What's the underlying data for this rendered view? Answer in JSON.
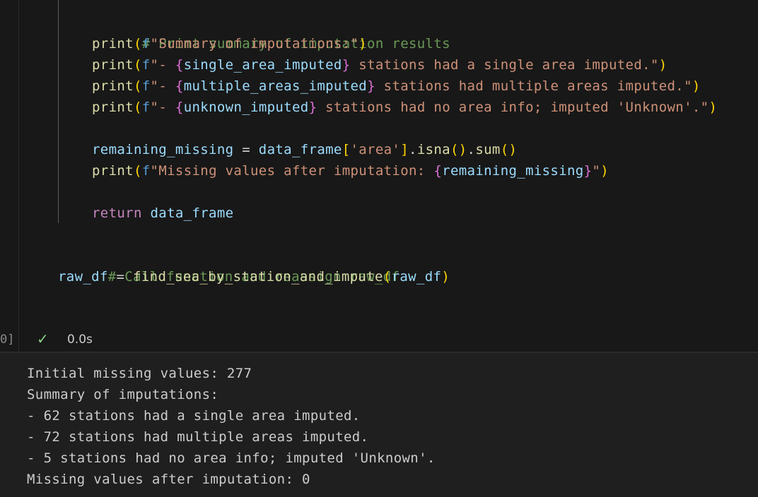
{
  "code": {
    "comment_print_summary": "# Print summary of imputation results",
    "line_summary": {
      "fn": "print",
      "p1": "(",
      "prefix": "f",
      "str": "\"Summary of imputations:\"",
      "p2": ")"
    },
    "line_single": {
      "fn": "print",
      "p1": "(",
      "prefix": "f",
      "s1": "\"- ",
      "b1": "{",
      "var": "single_area_imputed",
      "b2": "}",
      "s2": " stations had a single area imputed.\"",
      "p2": ")"
    },
    "line_multiple": {
      "fn": "print",
      "p1": "(",
      "prefix": "f",
      "s1": "\"- ",
      "b1": "{",
      "var": "multiple_areas_imputed",
      "b2": "}",
      "s2": " stations had multiple areas imputed.\"",
      "p2": ")"
    },
    "line_unknown": {
      "fn": "print",
      "p1": "(",
      "prefix": "f",
      "s1": "\"- ",
      "b1": "{",
      "var": "unknown_imputed",
      "b2": "}",
      "s2": " stations had no area info; imputed 'Unknown'.\"",
      "p2": ")"
    },
    "line_remaining": {
      "var": "remaining_missing",
      "eq": " = ",
      "obj": "data_frame",
      "br1": "[",
      "key": "'area'",
      "br2": "]",
      "dot1": ".",
      "m1": "isna",
      "pa": "()",
      "dot2": ".",
      "m2": "sum",
      "pb": "()"
    },
    "line_missing_print": {
      "fn": "print",
      "p1": "(",
      "prefix": "f",
      "s1": "\"Missing values after imputation: ",
      "b1": "{",
      "var": "remaining_missing",
      "b2": "}",
      "s2": "\"",
      "p2": ")"
    },
    "line_return": {
      "kw": "return",
      "var": " data_frame"
    },
    "comment_call": "# Call function and reassign raw_df",
    "line_call": {
      "var": "raw_df",
      "eq": " = ",
      "fn": "find_sea_by_station_and_impute",
      "p1": "(",
      "arg": "raw_df",
      "p2": ")"
    }
  },
  "status": {
    "exec_count": "0]",
    "check": "✓",
    "duration": "0.0s"
  },
  "output": [
    "Initial missing values: 277",
    "Summary of imputations:",
    "- 62 stations had a single area imputed.",
    "- 72 stations had multiple areas imputed.",
    "- 5 stations had no area info; imputed 'Unknown'.",
    "Missing values after imputation: 0"
  ],
  "colors": {
    "background": "#181818",
    "output_background": "#1f1f1f",
    "comment": "#6a9955",
    "function": "#dcdcaa",
    "string": "#ce9178",
    "keyword": "#c586c0",
    "variable": "#9cdcfe",
    "check": "#89d185"
  }
}
